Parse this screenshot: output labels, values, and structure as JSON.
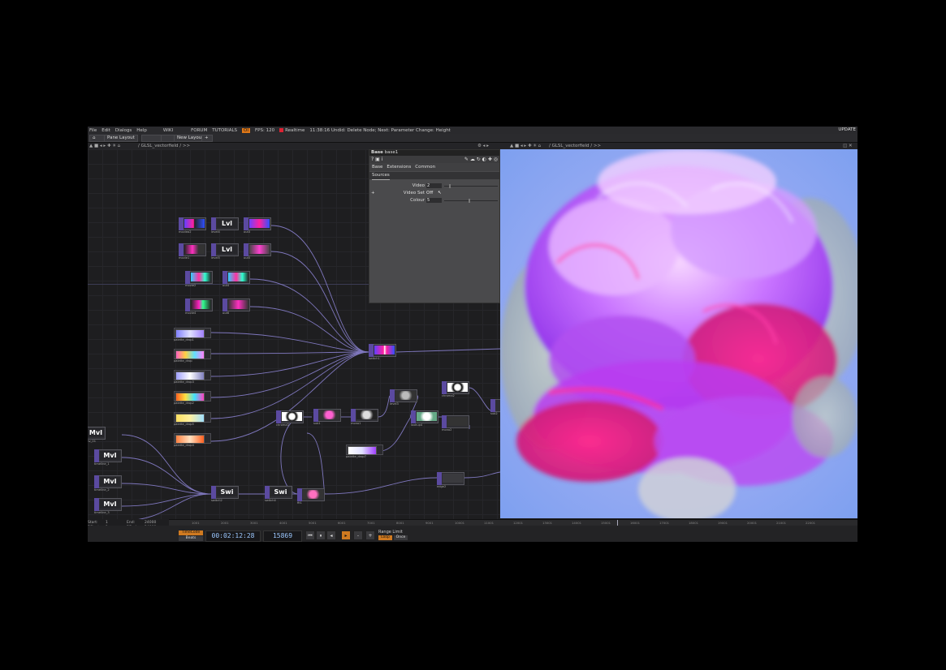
{
  "menu": {
    "items": [
      "File",
      "Edit",
      "Dialogs",
      "Help"
    ],
    "wiki": "WIKI",
    "forum": "FORUM",
    "tutorials": "TUTORIALS",
    "oi": "OI",
    "fps": "FPS:",
    "fps_value": "120",
    "realtime": "Realtime",
    "undo_status": "11:38:16 Undid: Delete Node; Next: Parameter Change: Height",
    "update": "UPDATE"
  },
  "toolbar": {
    "pane_layout": "Pane Layout",
    "new_layout": "New Layout"
  },
  "path": {
    "left": "/ GLSL_vectorfield / >>",
    "right": "/ GLSL_vectorfield / >>"
  },
  "param_panel": {
    "title_type": "Base",
    "title_name": "base1",
    "tabs": [
      "Base",
      "Extensions",
      "Common"
    ],
    "subtab": "Sources",
    "params": [
      {
        "label": "Video",
        "value": "2",
        "knob": 0.1
      },
      {
        "label": "Video Set",
        "value": "Off"
      },
      {
        "label": "Colour",
        "value": "5",
        "knob": 0.35
      }
    ]
  },
  "nodes": {
    "level_label": "Lvl",
    "switch_label": "Swi",
    "movie_label": "MvI",
    "names": {
      "moviea": "moviea2",
      "level4": "level4",
      "out3": "out3",
      "movieb": "movie1",
      "level5": "level5",
      "out5": "out5",
      "moviec": "movie2",
      "out4": "out4",
      "movied": "movie4",
      "out6": "out6",
      "switch1": "switch1",
      "switch2": "switch2",
      "switch4": "switch4",
      "p1": "palette_drop1",
      "p2": "palette_drop",
      "p3": "palette_drop3",
      "p4": "palette_drop2",
      "p5": "palette_drop5",
      "p6": "palette_drop4",
      "p7": "palette_drop7",
      "m1": "mv_01",
      "m2": "timeline_1",
      "m3": "timeline_2",
      "m4": "timeline_3",
      "chroma": "chroma3",
      "sub1": "sub1",
      "mono1": "mono1",
      "level3": "level3",
      "lookup": "lookup4",
      "chroma2": "chroma2",
      "mono2": "mono2",
      "fit1": "fit1",
      "edge2": "edge2",
      "sub2": "sub2"
    }
  },
  "stats": {
    "start_l": "Start:",
    "start_v": "1",
    "rstart_l": "RStart:",
    "rstart_v": "1",
    "fps_l": "FPS:",
    "fps_v": "120.0",
    "reset_l": "ResetF:",
    "reset_v": "1",
    "end_l": "End:",
    "end_v": "24000",
    "rend_l": "REnd:",
    "rend_v": "24000",
    "tempo_l": "Tempo:",
    "tempo_v": "120.0",
    "tsig_l": "T Sig:",
    "tsig_v": "4   4"
  },
  "transport": {
    "timecode_label": "TimeCode",
    "beats_label": "Beats",
    "timecode": "00:02:12:28",
    "frame": "15869",
    "range_limit": "Range Limit",
    "loop": "Loop",
    "once": "Once"
  },
  "timeline_ticks": [
    "1001",
    "2001",
    "3001",
    "4001",
    "5001",
    "6001",
    "7001",
    "8001",
    "9001",
    "10001",
    "11001",
    "12001",
    "13001",
    "14001",
    "15001",
    "16001",
    "17001",
    "18001",
    "19001",
    "20001",
    "21001",
    "22001"
  ],
  "colors": {
    "accent": "#d07a20",
    "node_side": "#5b4aa0",
    "wire": "#8f86d8"
  }
}
